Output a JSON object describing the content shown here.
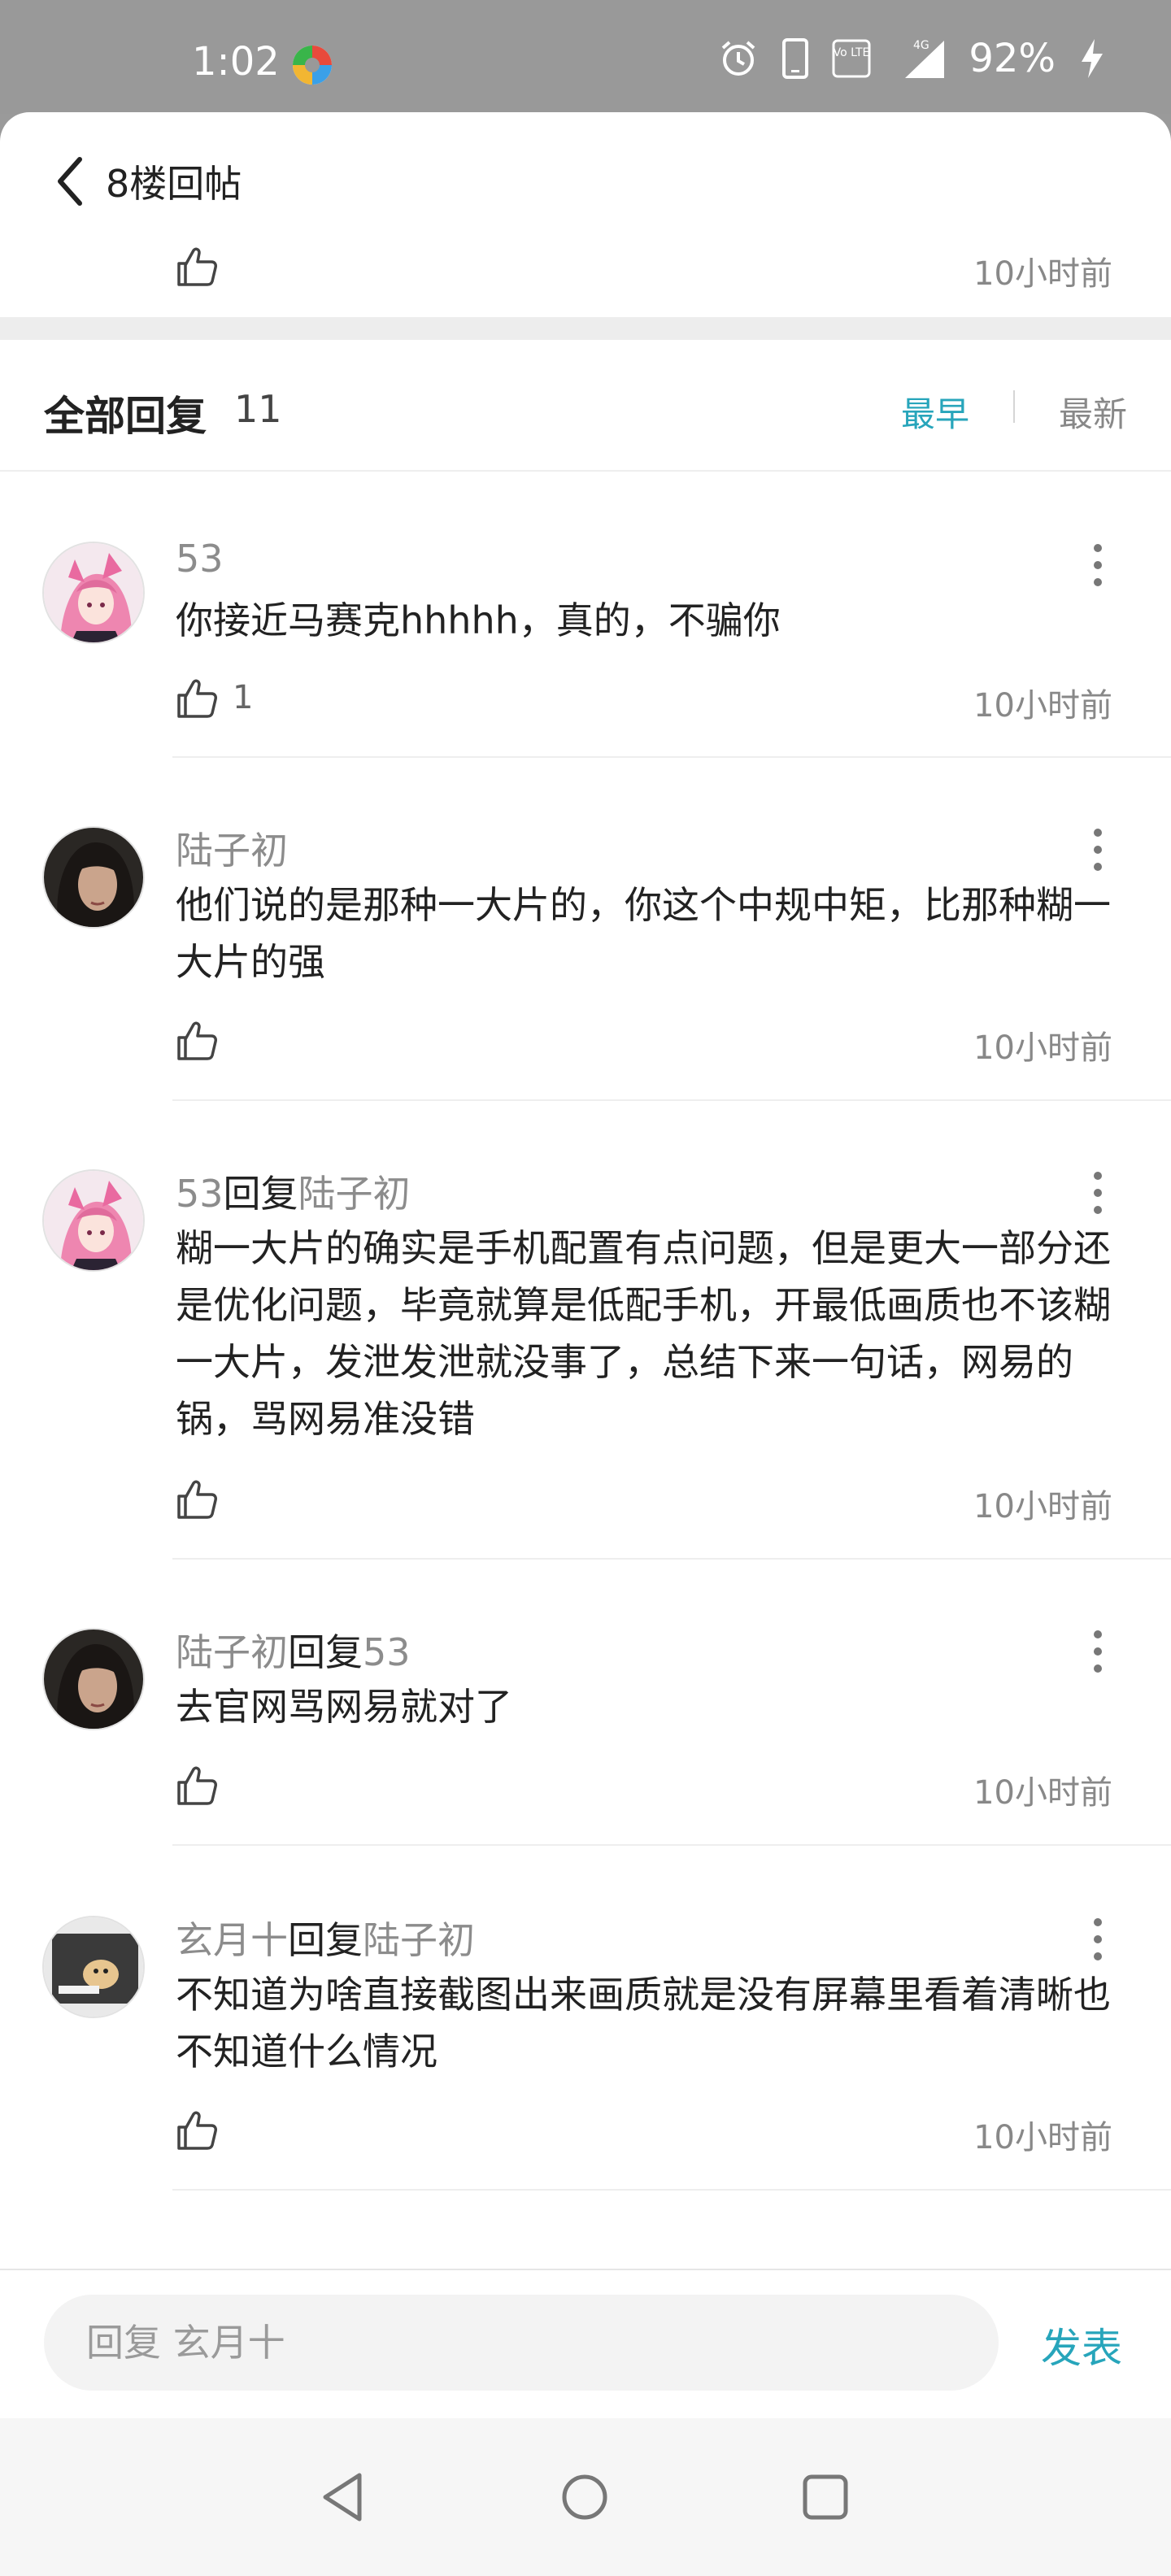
{
  "status_bar": {
    "time": "1:02",
    "network": "4G",
    "volte": "Vo LTE",
    "battery": "92%",
    "icons": [
      "alarm-icon",
      "phone-icon",
      "volte-icon",
      "signal-icon",
      "charging-icon"
    ]
  },
  "header": {
    "title": "8楼回帖"
  },
  "post_footer": {
    "time": "10小时前"
  },
  "replies_section": {
    "title": "全部回复",
    "count": "11",
    "sort_earliest": "最早",
    "sort_latest": "最新"
  },
  "replies": [
    {
      "author": "53",
      "reply_word": "",
      "reply_to": "",
      "text": "你接近马赛克hhhhh，真的，不骗你",
      "likes": "1",
      "time": "10小时前"
    },
    {
      "author": "陆子初",
      "reply_word": "",
      "reply_to": "",
      "text": "他们说的是那种一大片的，你这个中规中矩，比那种糊一大片的强",
      "likes": "",
      "time": "10小时前"
    },
    {
      "author": "53",
      "reply_word": "回复",
      "reply_to": "陆子初",
      "text": "糊一大片的确实是手机配置有点问题，但是更大一部分还是优化问题，毕竟就算是低配手机，开最低画质也不该糊一大片，发泄发泄就没事了，总结下来一句话，网易的锅，骂网易准没错",
      "likes": "",
      "time": "10小时前"
    },
    {
      "author": "陆子初",
      "reply_word": "回复",
      "reply_to": "53",
      "text": "去官网骂网易就对了",
      "likes": "",
      "time": "10小时前"
    },
    {
      "author": "玄月十",
      "reply_word": "回复",
      "reply_to": "陆子初",
      "text": "不知道为啥直接截图出来画质就是没有屏幕里看着清晰也不知道什么情况",
      "likes": "",
      "time": "10小时前"
    }
  ],
  "input_bar": {
    "placeholder": "回复 玄月十",
    "send_label": "发表"
  },
  "colors": {
    "accent": "#27a5bb",
    "status_bar_bg": "#999999",
    "muted_text": "#8c8c8c"
  }
}
